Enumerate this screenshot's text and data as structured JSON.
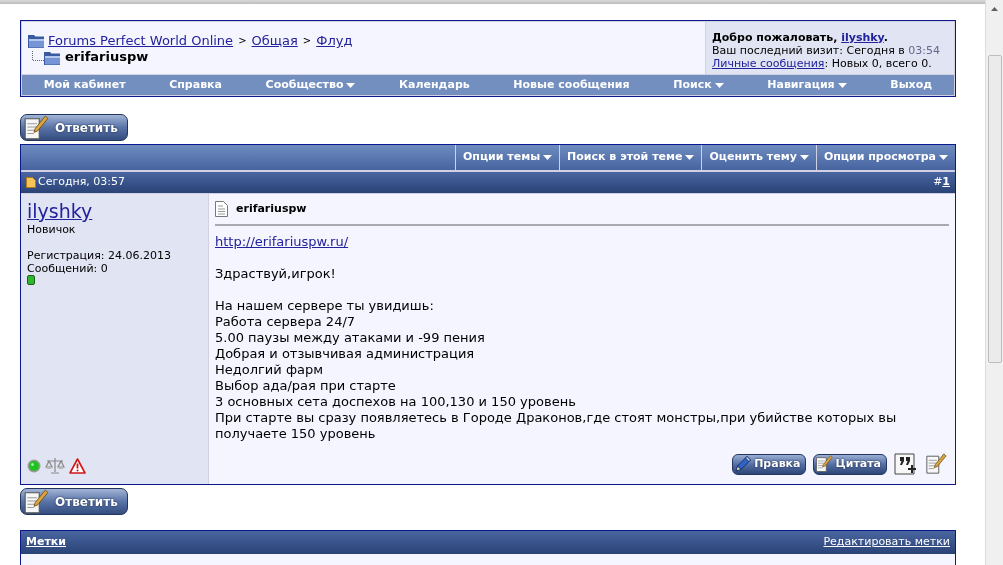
{
  "breadcrumb": {
    "items": [
      {
        "label": "Forums Perfect World Online"
      },
      {
        "separator": ">",
        "label": "Общая"
      },
      {
        "separator": ">",
        "label": "Флуд"
      }
    ],
    "current": "erifariuspw"
  },
  "welcome": {
    "greeting": "Добро пожаловать,",
    "username": "ilyshky",
    "greeting_end": ".",
    "last_visit": "Ваш последний визит: Сегодня в",
    "last_visit_time": "03:54",
    "messages_link": "Личные сообщения",
    "messages_info": ": Новых 0, всего 0."
  },
  "nav": [
    {
      "label": "Мой кабинет",
      "dropdown": false
    },
    {
      "label": "Справка",
      "dropdown": false
    },
    {
      "label": "Сообщество",
      "dropdown": true
    },
    {
      "label": "Календарь",
      "dropdown": false
    },
    {
      "label": "Новые сообщения",
      "dropdown": false
    },
    {
      "label": "Поиск",
      "dropdown": true
    },
    {
      "label": "Навигация",
      "dropdown": true
    },
    {
      "label": "Выход",
      "dropdown": false
    }
  ],
  "reply_top": {
    "label": "Ответить"
  },
  "thread_tools": [
    {
      "label": "Опции темы",
      "dropdown": true
    },
    {
      "label": "Поиск в этой теме",
      "dropdown": true
    },
    {
      "label": "Оценить тему",
      "dropdown": true
    },
    {
      "label": "Опции просмотра",
      "dropdown": true
    }
  ],
  "post": {
    "date": "Сегодня, 03:57",
    "number_prefix": "#",
    "number": "1",
    "author": {
      "name": "ilyshky",
      "title": "Новичок",
      "registration": "Регистрация: 24.06.2013",
      "posts": "Сообщений: 0",
      "online": true
    },
    "title": "erifariuspw",
    "link": "http://erifariuspw.ru/",
    "paragraphs": [
      [
        "Здраствуй,игрок!"
      ],
      [
        "На нашем сервере ты увидишь:",
        "Работа сервера 24/7",
        "5.00 паузы между атаками и -99 пения",
        "Добрая и отзывчивая администрация",
        "Недолгий фарм",
        "Выбор ада/рая при старте",
        "3 основных сета доспехов на 100,130 и 150 уровень",
        "При старте вы сразу появляетесь в Городе Драконов,где стоят монстры,при убийстве которых вы получаете 150 уровень"
      ]
    ],
    "buttons": [
      {
        "kind": "edit",
        "label": "Правка"
      },
      {
        "kind": "quote",
        "label": "Цитата"
      },
      {
        "kind": "multiquote"
      },
      {
        "kind": "quickreply"
      }
    ]
  },
  "reply_bottom": {
    "label": "Ответить"
  },
  "tags": {
    "title": "Метки",
    "edit_link": "Редактировать метки"
  }
}
